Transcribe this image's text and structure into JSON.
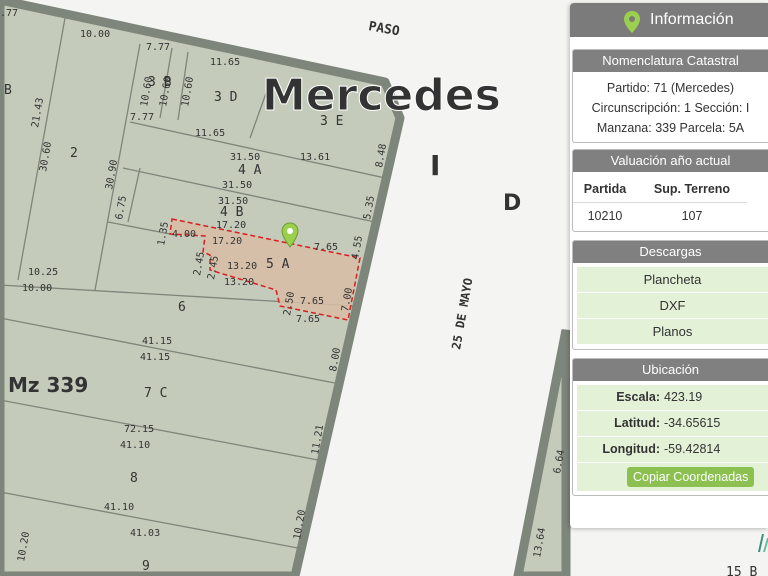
{
  "map": {
    "locality": "Mercedes",
    "streets": {
      "paso": "PASO",
      "mayo": "25 DE MAYO"
    },
    "sections": {
      "i": "I",
      "d": "D"
    },
    "manzana": "Mz 339",
    "selected_parcel": "5 A",
    "parcels": [
      "2",
      "3 B",
      "3 D",
      "3 E",
      "4 A",
      "4 B",
      "6",
      "7 C",
      "8",
      "9",
      "B",
      "15 B"
    ],
    "dimensions": [
      "10.00",
      "7.77",
      "11.65",
      "10.60",
      "10.60",
      "10.60",
      "7.77",
      "21.43",
      "30.60",
      "11.65",
      "30.90",
      "31.50",
      "31.50",
      "13.61",
      "8.48",
      "31.50",
      "6.75",
      "5.35",
      "17.20",
      "4.00",
      "17.20",
      "1.35",
      "7.65",
      "4.55",
      "2.45",
      "2.45",
      "13.20",
      "13.20",
      "2.50",
      "7.65",
      "7.65",
      "7.00",
      "10.25",
      "10.00",
      "41.15",
      "41.15",
      "8.00",
      "72.15",
      "41.10",
      "11.21",
      "41.10",
      "41.03",
      "10.20",
      "10.20",
      "6.64",
      "13.64",
      ".77"
    ],
    "colors": {
      "block": "#c4cbbb",
      "lines": "#7e857a",
      "selected_fill": "#d9bda4",
      "selected_border": "#d62020",
      "pin": "#9bd04e"
    }
  },
  "panel": {
    "title": "Información",
    "title_icon": "map-marker-icon",
    "nomenclatura": {
      "header": "Nomenclatura Catastral",
      "partido": "Partido: 71 (Mercedes)",
      "circ": "Circunscripción: 1 Sección: I",
      "manzana": "Manzana: 339 Parcela: 5A"
    },
    "valuacion": {
      "header": "Valuación año actual",
      "col_partida": "Partida",
      "col_sup": "Sup. Terreno",
      "partida": "10210",
      "sup": "107"
    },
    "descargas": {
      "header": "Descargas",
      "items": [
        "Plancheta",
        "DXF",
        "Planos"
      ]
    },
    "ubicacion": {
      "header": "Ubicación",
      "escala_k": "Escala:",
      "escala_v": "423.19",
      "lat_k": "Latitud:",
      "lat_v": "-34.65615",
      "lon_k": "Longitud:",
      "lon_v": "-59.42814",
      "button": "Copiar Coordenadas"
    }
  }
}
